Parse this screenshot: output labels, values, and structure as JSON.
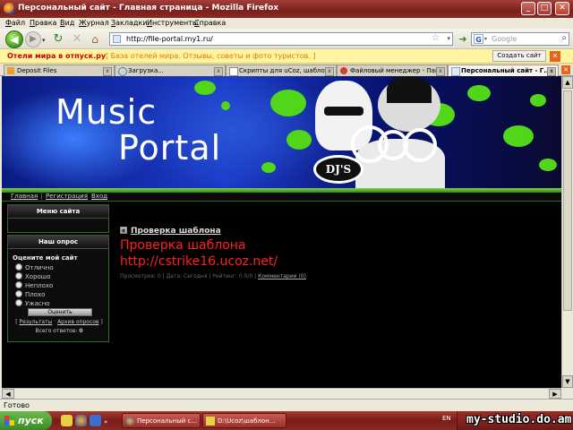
{
  "window": {
    "title": "Персональный сайт - Главная страница - Mozilla Firefox"
  },
  "menu": [
    "Файл",
    "Правка",
    "Вид",
    "Журнал",
    "Закладки",
    "Инструменты",
    "Справка"
  ],
  "nav": {
    "url": "http://file-portal.my1.ru/",
    "search_placeholder": "Google"
  },
  "adbar": {
    "link": "Отели мира в отпуск.ру",
    "text": "[ База отелей мира. Отзывы, советы и фото туристов. ]",
    "create_site": "Создать сайт"
  },
  "tabs": [
    {
      "label": "Deposit Files",
      "active": false
    },
    {
      "label": "Загрузка...",
      "active": false
    },
    {
      "label": "Скрипты для uCoz, шабло...",
      "active": false
    },
    {
      "label": "Файловый менеджер - Пан...",
      "active": false
    },
    {
      "label": "Персональный сайт - Г...",
      "active": true
    }
  ],
  "site": {
    "logo_line1": "Music",
    "logo_line2": "Portal",
    "dj_badge": "DJ'S",
    "nav": {
      "home": "Главная",
      "register": "Регистрация",
      "login": "Вход",
      "sep": "|"
    },
    "menu_title": "Меню сайта",
    "poll": {
      "title": "Наш опрос",
      "question": "Оцените мой сайт",
      "options": [
        "Отлично",
        "Хорошо",
        "Неплохо",
        "Плохо",
        "Ужасно"
      ],
      "vote_button": "Оценить",
      "results": "Результаты",
      "archive": "Архив опросов",
      "total_label": "Всего ответов:",
      "total": "0"
    },
    "post": {
      "title": "Проверка шаблона",
      "heading": "Проверка шаблона",
      "url": "http://cstrike16.ucoz.net/",
      "meta": "Просмотров: 0 | Дата: Сегодня | Рейтинг: 0.0/0 |",
      "comments": "Комментарии (0)"
    }
  },
  "status": "Готово",
  "taskbar": {
    "start": "пуск",
    "tasks": [
      "Персональный с...",
      "D:\\Ucoz\\шаблон..."
    ],
    "lang": "EN",
    "watermark": "my-studio.do.am"
  },
  "colors": {
    "accent_green": "#52d61a",
    "post_red": "#ff2020",
    "titlebar": "#8a2a26"
  }
}
